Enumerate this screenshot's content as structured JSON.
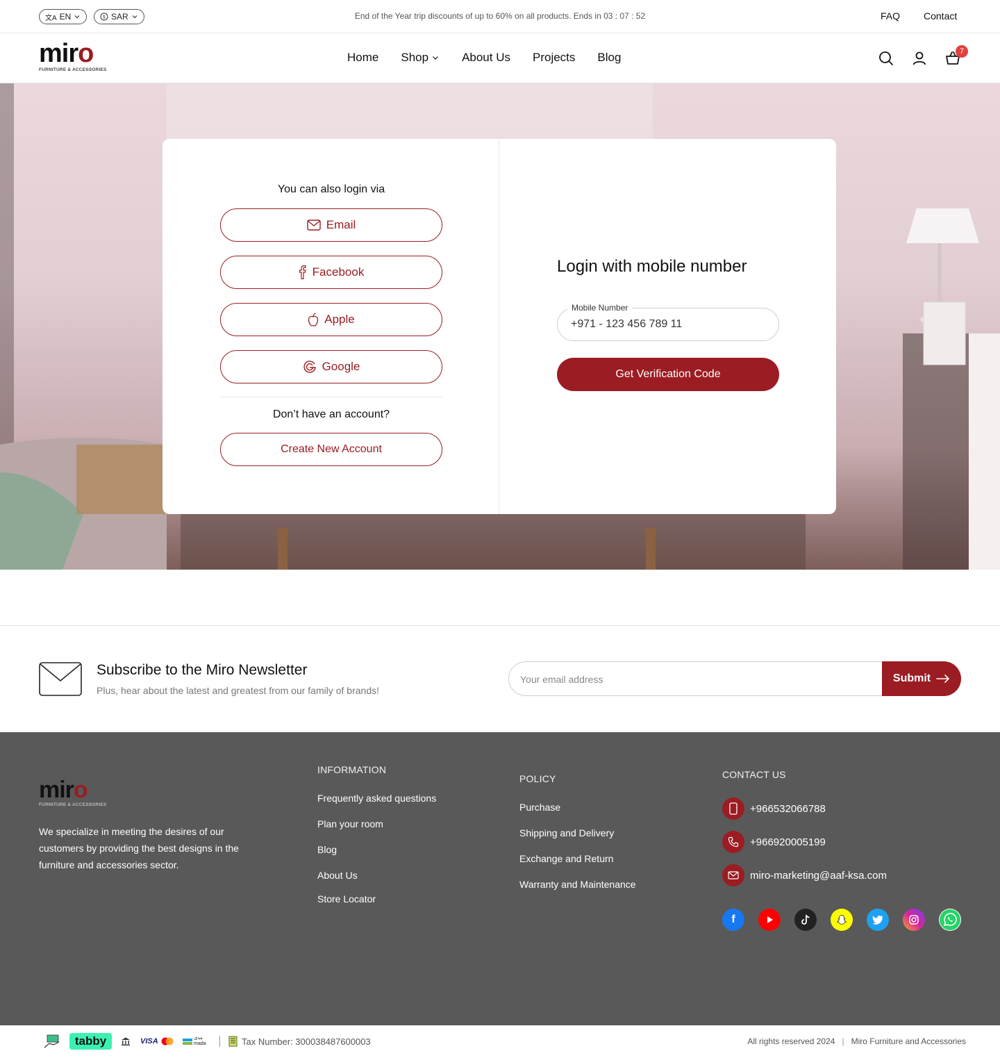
{
  "topbar": {
    "language": "EN",
    "currency": "SAR",
    "promo": "End of the Year trip discounts of up to 60% on all products. Ends in 03 : 07 : 52",
    "faq": "FAQ",
    "contact": "Contact"
  },
  "brand": {
    "name_prefix": "mir",
    "name_suffix": "o",
    "tagline": "Furniture & Accessories",
    "accent_color": "#9b1c22"
  },
  "nav": {
    "items": [
      "Home",
      "Shop",
      "About Us",
      "Projects",
      "Blog"
    ],
    "cart_count": "7"
  },
  "login": {
    "also_via": "You can also login via",
    "providers": [
      {
        "label": "Email",
        "icon": "mail-icon"
      },
      {
        "label": "Facebook",
        "icon": "facebook-icon"
      },
      {
        "label": "Apple",
        "icon": "apple-icon"
      },
      {
        "label": "Google",
        "icon": "google-icon"
      }
    ],
    "no_account": "Don’t have an account?",
    "create_account": "Create New Account",
    "mobile_title": "Login with mobile number",
    "mobile_label": "Mobile Number",
    "mobile_value": "+971 - 123 456 789 11",
    "verify_button": "Get Verification Code"
  },
  "newsletter": {
    "title": "Subscribe to the Miro Newsletter",
    "subtitle": "Plus, hear about the latest and greatest from our family of brands!",
    "placeholder": "Your email address",
    "submit": "Submit"
  },
  "footer": {
    "description": "We specialize in meeting the desires of our customers by providing the best designs in the furniture and accessories sector.",
    "information": {
      "heading": "INFORMATION",
      "links": [
        "Frequently asked questions",
        "Plan your room",
        "Blog",
        "About Us",
        "Store Locator"
      ]
    },
    "policy": {
      "heading": "POLICY",
      "links": [
        "Purchase",
        "Shipping and Delivery",
        "Exchange and Return",
        "Warranty and Maintenance"
      ]
    },
    "contact": {
      "heading": "CONTACT US",
      "mobile": "+966532066788",
      "phone": "+966920005199",
      "email": "miro-marketing@aaf-ksa.com"
    },
    "socials": [
      {
        "name": "facebook-icon",
        "color": "#1877f2"
      },
      {
        "name": "youtube-icon",
        "color": "#ff0000"
      },
      {
        "name": "tiktok-icon",
        "color": "#222222"
      },
      {
        "name": "snapchat-icon",
        "color": "#fffc00"
      },
      {
        "name": "twitter-icon",
        "color": "#1da1f2"
      },
      {
        "name": "instagram-icon",
        "color": "#d6249f"
      },
      {
        "name": "whatsapp-icon",
        "color": "#25d366"
      }
    ]
  },
  "bottom": {
    "tabby": "tabby",
    "visa": "VISA",
    "mada": "mada",
    "mada_ar": "مدى",
    "tax": "Tax Number: 300038487600003",
    "rights": "All rights reserved 2024",
    "company": "Miro Furniture and Accessories"
  }
}
